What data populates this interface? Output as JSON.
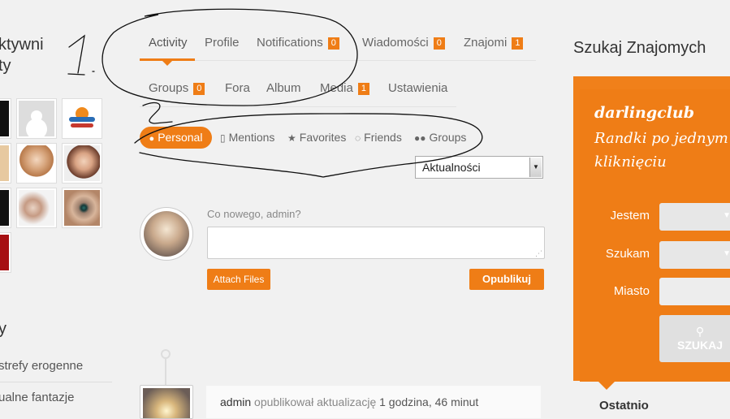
{
  "left": {
    "title_line1": "ktywni",
    "title_line2": "ty",
    "subtitle": "y",
    "links": [
      "strefy erogenne",
      "ualne fantazje"
    ]
  },
  "tabs_row1": [
    {
      "label": "Activity",
      "badge": null
    },
    {
      "label": "Profile",
      "badge": null
    },
    {
      "label": "Notifications",
      "badge": "0"
    },
    {
      "label": "Wiadomości",
      "badge": "0"
    },
    {
      "label": "Znajomi",
      "badge": "1"
    }
  ],
  "tabs_row2": [
    {
      "label": "Groups",
      "badge": "0"
    },
    {
      "label": "Fora",
      "badge": null
    },
    {
      "label": "Album",
      "badge": null
    },
    {
      "label": "Media",
      "badge": "1"
    },
    {
      "label": "Ustawienia",
      "badge": null
    }
  ],
  "filters": {
    "personal": "Personal",
    "mentions": "Mentions",
    "favorites": "Favorites",
    "friends": "Friends",
    "groups": "Groups"
  },
  "select_value": "Aktualności",
  "post": {
    "prompt": "Co nowego, admin?",
    "attach_label": "Attach Files",
    "publish_label": "Opublikuj"
  },
  "activity": {
    "who": "admin",
    "action": "opublikował aktualizację",
    "time": "1 godzina, 46 minut"
  },
  "widget": {
    "title": "Szukaj Znajomych",
    "brand": "darlingclub",
    "tagline": "Randki po jednym kliknięciu",
    "label_jestem": "Jestem",
    "label_szukam": "Szukam",
    "label_miasto": "Miasto",
    "search_label": "SZUKAJ",
    "below": "Ostatnio"
  },
  "colors": {
    "accent": "#ef7d16"
  }
}
